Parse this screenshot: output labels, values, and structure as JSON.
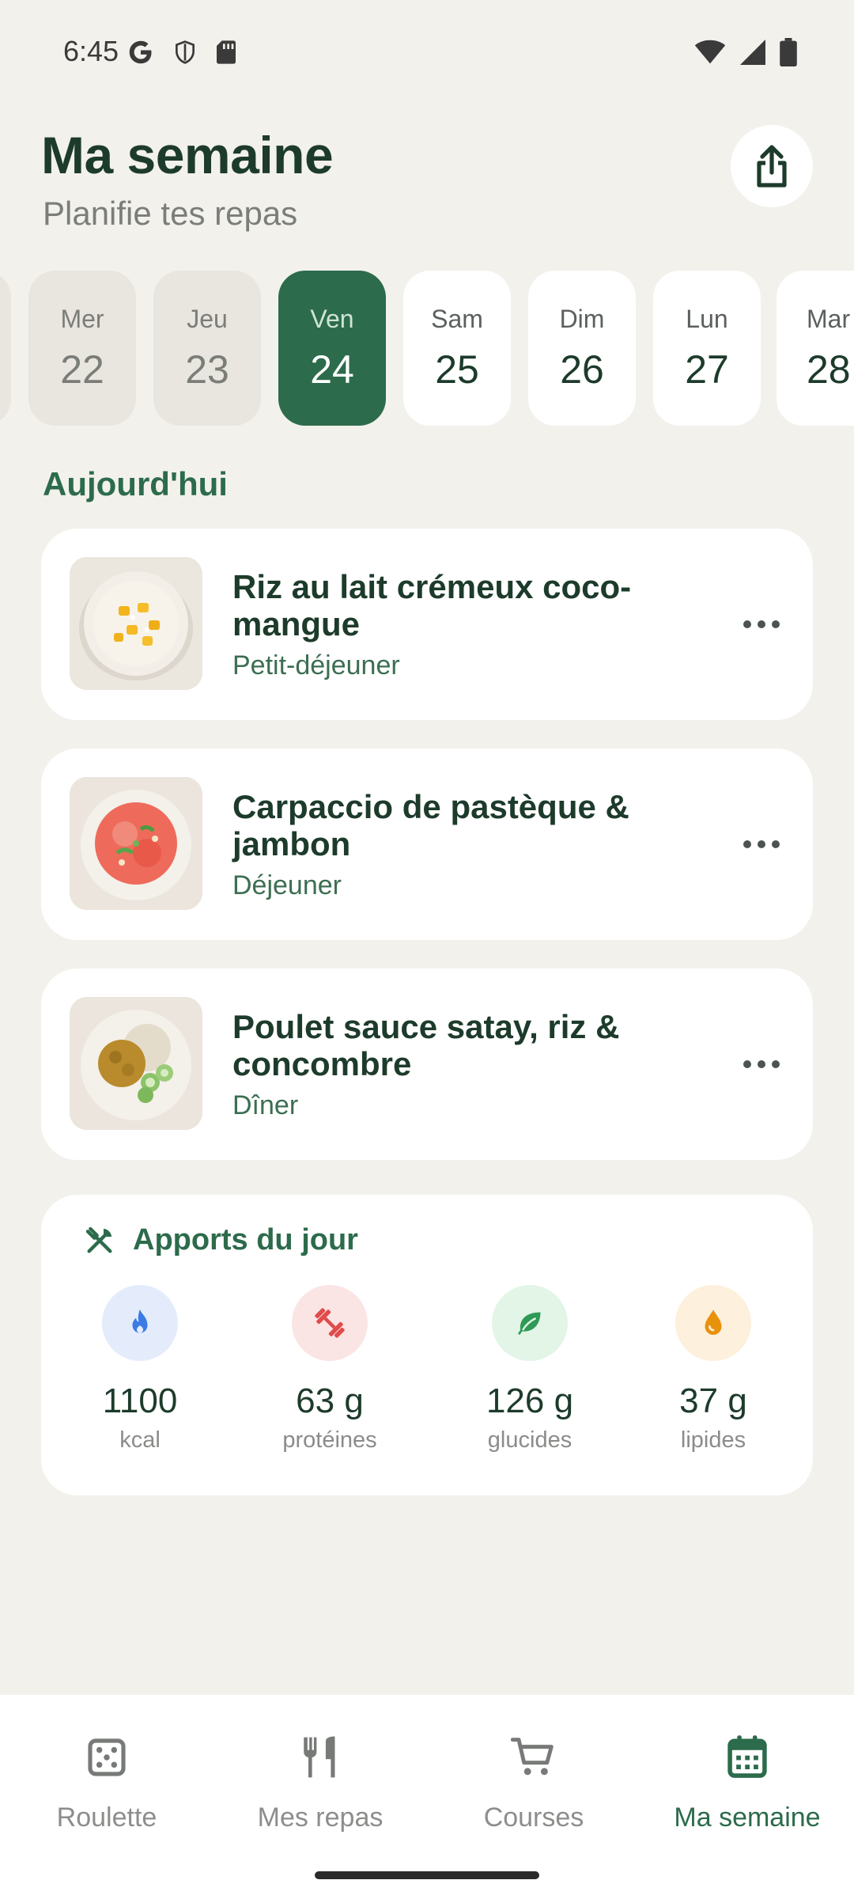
{
  "status_bar": {
    "time": "6:45"
  },
  "header": {
    "title": "Ma semaine",
    "subtitle": "Planifie tes repas"
  },
  "days": [
    {
      "name": "Mer",
      "num": "22"
    },
    {
      "name": "Jeu",
      "num": "23"
    },
    {
      "name": "Ven",
      "num": "24"
    },
    {
      "name": "Sam",
      "num": "25"
    },
    {
      "name": "Dim",
      "num": "26"
    },
    {
      "name": "Lun",
      "num": "27"
    },
    {
      "name": "Mar",
      "num": "28"
    }
  ],
  "section": {
    "title": "Aujourd'hui"
  },
  "meals": [
    {
      "title": "Riz au lait crémeux coco-mangue",
      "type": "Petit-déjeuner"
    },
    {
      "title": "Carpaccio de pastèque & jambon",
      "type": "Déjeuner"
    },
    {
      "title": "Poulet sauce satay, riz & concombre",
      "type": "Dîner"
    }
  ],
  "nutrition": {
    "title": "Apports du jour",
    "items": [
      {
        "value": "1100",
        "label": "kcal",
        "icon": "flame-icon",
        "color": "#3b7be6",
        "bg": "#e4ecfb"
      },
      {
        "value": "63 g",
        "label": "protéines",
        "icon": "dumbbell-icon",
        "color": "#e04b4b",
        "bg": "#fbe4e4"
      },
      {
        "value": "126 g",
        "label": "glucides",
        "icon": "leaf-icon",
        "color": "#2f9a55",
        "bg": "#e2f5e7"
      },
      {
        "value": "37 g",
        "label": "lipides",
        "icon": "drop-icon",
        "color": "#e8920c",
        "bg": "#fdf0dc"
      }
    ]
  },
  "bottom_nav": [
    {
      "label": "Roulette",
      "icon": "dice-icon"
    },
    {
      "label": "Mes repas",
      "icon": "fork-knife-icon"
    },
    {
      "label": "Courses",
      "icon": "cart-icon"
    },
    {
      "label": "Ma semaine",
      "icon": "calendar-icon"
    }
  ],
  "colors": {
    "accent": "#2c6b4b",
    "background": "#f3f1ec"
  }
}
